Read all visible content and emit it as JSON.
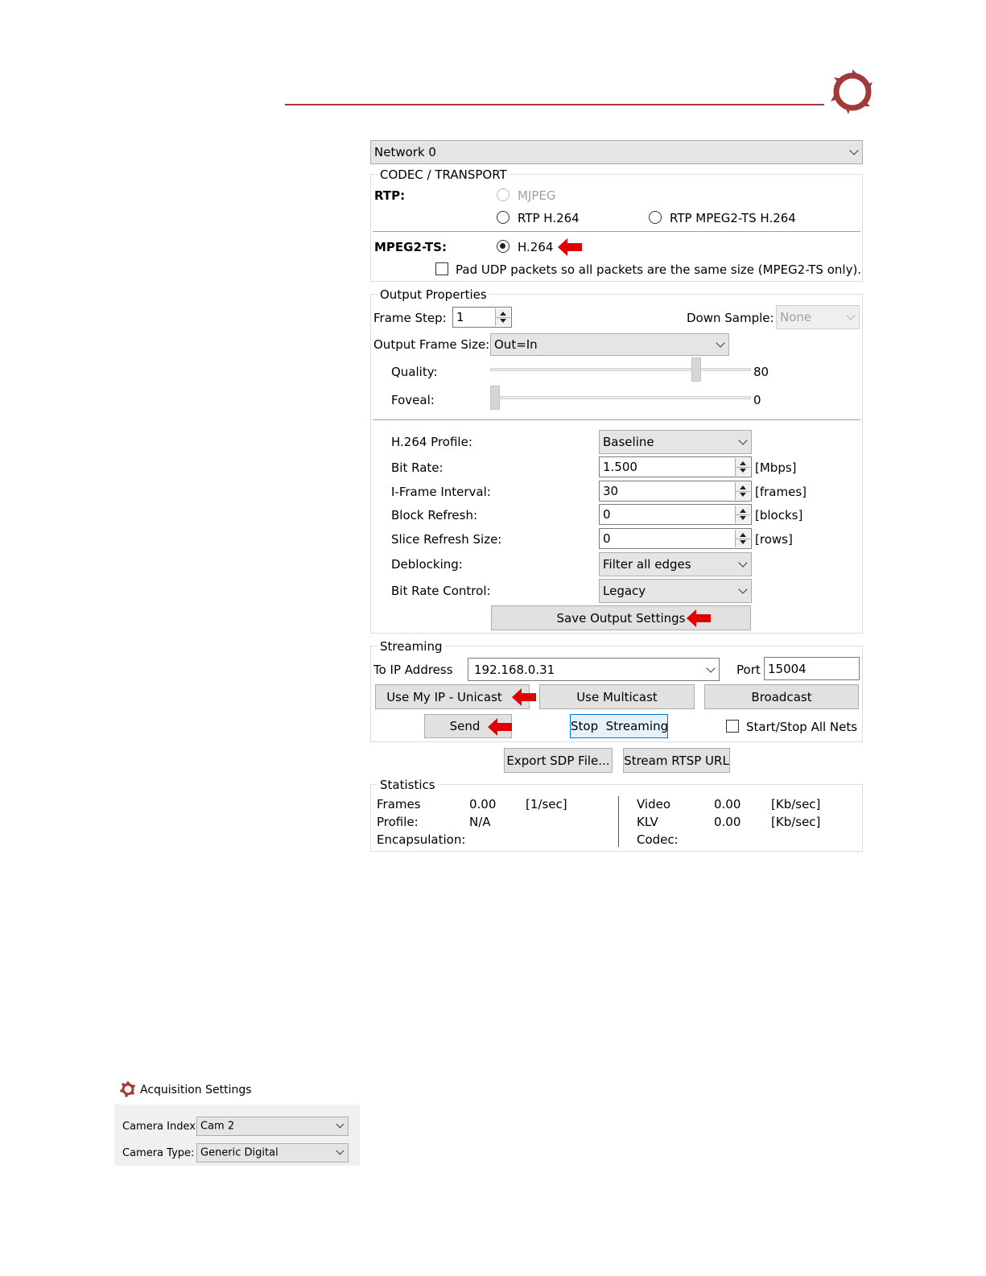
{
  "colors": {
    "header_line": "#a33a3a",
    "logo": "#a33a3a",
    "arrow": "#e00000",
    "selected_button_border": "#0078d7"
  },
  "icons": {
    "logo": "company-logo-icon",
    "pointer": "red-arrow-icon"
  },
  "network": {
    "selected": "Network 0"
  },
  "codec": {
    "group_label": "CODEC / TRANSPORT",
    "rtp_label": "RTP:",
    "mjpeg": "MJPEG",
    "rtp_h264": "RTP H.264",
    "rtp_mpeg2ts_h264": "RTP MPEG2-TS H.264",
    "mpeg2ts_label": "MPEG2-TS:",
    "h264": "H.264",
    "selected": "H.264",
    "pad_udp": "Pad UDP packets so all packets are the same size (MPEG2-TS only)."
  },
  "output": {
    "group_label": "Output Properties",
    "frame_step_label": "Frame Step:",
    "frame_step_value": "1",
    "down_sample_label": "Down Sample:",
    "down_sample_value": "None",
    "output_frame_size_label": "Output Frame Size:",
    "output_frame_size_value": "Out=In",
    "quality_label": "Quality:",
    "quality_value": "80",
    "quality_level": 80,
    "foveal_label": "Foveal:",
    "foveal_value": "0",
    "foveal_level": 0,
    "h264_profile_label": "H.264 Profile:",
    "h264_profile_value": "Baseline",
    "bit_rate_label": "Bit Rate:",
    "bit_rate_value": "1.500",
    "bit_rate_unit": "[Mbps]",
    "iframe_label": "I-Frame Interval:",
    "iframe_value": "30",
    "iframe_unit": "[frames]",
    "block_refresh_label": "Block Refresh:",
    "block_refresh_value": "0",
    "block_refresh_unit": "[blocks]",
    "slice_refresh_label": "Slice Refresh Size:",
    "slice_refresh_value": "0",
    "slice_refresh_unit": "[rows]",
    "deblocking_label": "Deblocking:",
    "deblocking_value": "Filter all edges",
    "bit_rate_control_label": "Bit Rate Control:",
    "bit_rate_control_value": "Legacy",
    "save_button": "Save Output Settings"
  },
  "streaming": {
    "group_label": "Streaming",
    "to_ip_label": "To IP Address",
    "to_ip_value": "192.168.0.31",
    "port_label": "Port",
    "port_value": "15004",
    "use_my_ip": "Use My IP - Unicast",
    "use_multicast": "Use Multicast",
    "broadcast": "Broadcast",
    "send": "Send",
    "stop_streaming": "Stop  Streaming",
    "start_stop_all": "Start/Stop All Nets"
  },
  "export_sdp": "Export SDP File...",
  "stream_rtsp": "Stream RTSP URL",
  "statistics": {
    "group_label": "Statistics",
    "frames_label": "Frames",
    "frames_value": "0.00",
    "frames_unit": "[1/sec]",
    "profile_label": "Profile:",
    "profile_value": "N/A",
    "encapsulation_label": "Encapsulation:",
    "video_label": "Video",
    "video_value": "0.00",
    "video_unit": "[Kb/sec]",
    "klv_label": "KLV",
    "klv_value": "0.00",
    "klv_unit": "[Kb/sec]",
    "codec_label": "Codec:"
  },
  "acquisition": {
    "title": "Acquisition Settings",
    "camera_index_label": "Camera Index:",
    "camera_index_value": "Cam 2",
    "camera_type_label": "Camera Type:",
    "camera_type_value": "Generic Digital"
  }
}
